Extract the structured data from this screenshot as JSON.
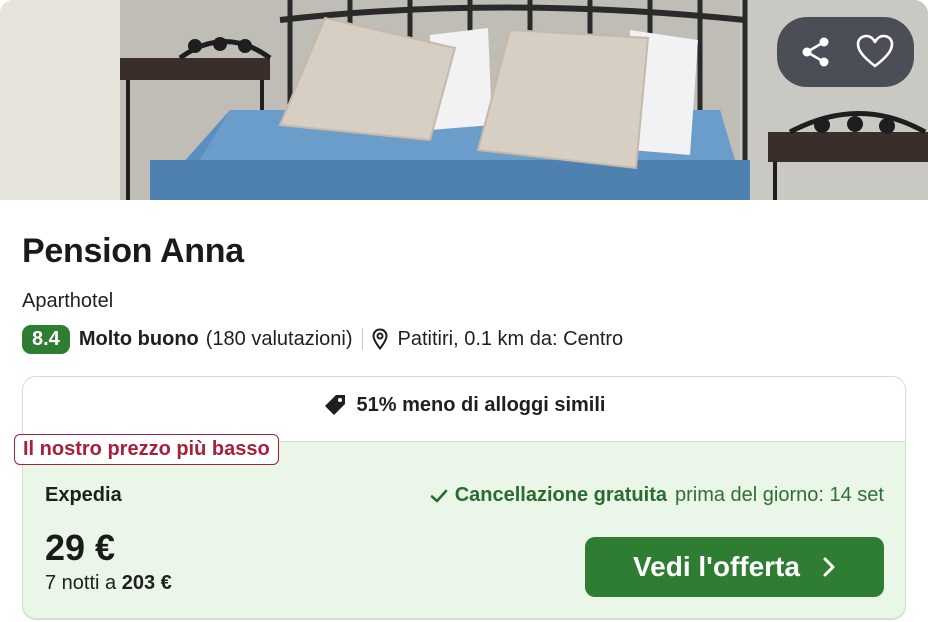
{
  "hero": {
    "photo_subject": "bedroom with blue bedspread, beige pillows and black iron headboard",
    "share_icon": "share-icon",
    "favorite_icon": "heart-icon"
  },
  "hotel": {
    "name": "Pension Anna",
    "type": "Aparthotel",
    "rating": {
      "score": "8.4",
      "label": "Molto buono",
      "count": "(180 valutazioni)"
    },
    "location": "Patitiri, 0.1 km da: Centro"
  },
  "deal": {
    "headline": "51% meno di alloggi simili",
    "badge": "Il nostro prezzo più basso",
    "provider": "Expedia",
    "cancellation_strong": "Cancellazione gratuita",
    "cancellation_rest": "prima del giorno: 14 set",
    "price": "29 €",
    "nights_text": "7 notti a",
    "total": "203 €",
    "cta": "Vedi l'offerta"
  },
  "colors": {
    "accent_green": "#2f7d32",
    "offer_bg": "#eaf7e8",
    "badge_red": "#a8203a"
  }
}
